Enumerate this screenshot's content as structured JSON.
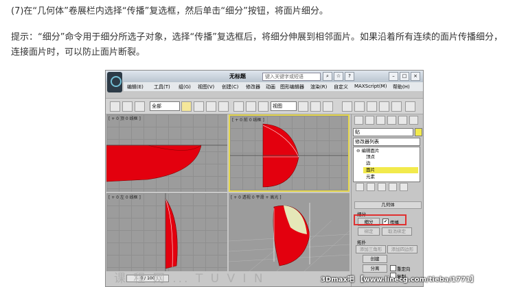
{
  "article": {
    "step_text": "(7)在“几何体”卷展栏内选择“传播”复选框，然后单击“细分”按钮，将面片细分。",
    "tip_text": "提示：“细分”命令用于细分所选子对象，选择“传播”复选框后，将细分伸展到相邻面片。如果沿着所有连续的面片传播细分，连接面片时，可以防止面片断裂。"
  },
  "screenshot": {
    "window_title": "无标题",
    "search_placeholder": "键入关键字或短语",
    "menu": [
      "编辑(E)",
      "工具(T)",
      "组(G)",
      "视图(V)",
      "创建(C)",
      "修改器",
      "动画",
      "图形编辑器",
      "渲染(R)",
      "自定义",
      "MAXScript(M)",
      "帮助(H)"
    ],
    "toolbar": {
      "selection_filter": "全部",
      "view_dropdown": "视图"
    },
    "viewports": {
      "top": "[ + 0 顶 0 线框 ]",
      "front": "[ + 0 前 0 线框 ]",
      "left": "[ + 0 左 0 线框 ]",
      "perspective": "[ + 0 透视 0 平滑 + 高光 ]"
    },
    "frame_slider": "0 / 100",
    "object_name": "贴",
    "modifier_list": "修改器列表",
    "stack": [
      {
        "label": "编辑面片",
        "level": 0
      },
      {
        "label": "顶点",
        "level": 1
      },
      {
        "label": "边",
        "level": 1
      },
      {
        "label": "面片",
        "level": 1,
        "selected": true
      },
      {
        "label": "元素",
        "level": 1
      }
    ],
    "geometry": {
      "title": "几何体",
      "subdivide_group": "细分",
      "subdivide_button": "细分",
      "propagate_label": "传播",
      "propagate_checked": true,
      "bind_button": "绑定",
      "unbind_button": "取消绑定",
      "topology_group": "拓扑",
      "add_tri_button": "添加三角形",
      "add_quad_button": "添加四边形",
      "create_button": "创建",
      "detach_button": "分离",
      "reorient_label": "重定向",
      "copy_label": "复制"
    },
    "colors": {
      "object_red": "#e3000e",
      "highlight_yellow": "#f2ea4c",
      "callout_red": "#e03030"
    }
  },
  "watermark": {
    "site_text": "3Dmax吧 【www.linecg.com/tieba/1771】",
    "faint_text": "课 程 网 ... T U V I N"
  }
}
